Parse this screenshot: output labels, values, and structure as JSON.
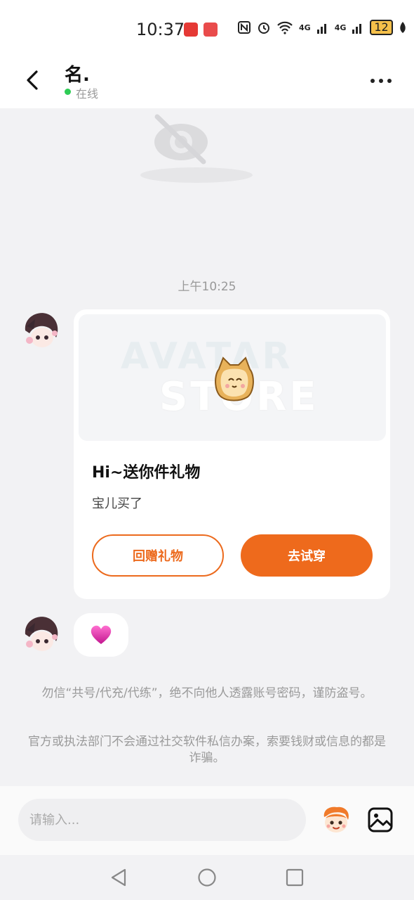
{
  "status_bar": {
    "time": "10:37",
    "battery": "12",
    "network_labels": [
      "4G",
      "4G"
    ]
  },
  "header": {
    "title": "名.",
    "status": "在线",
    "status_color": "#2ecc55"
  },
  "chat": {
    "timestamp": "上午10:25",
    "gift_card": {
      "banner_watermark_1": "AVATAR",
      "banner_watermark_2": "STORE",
      "title": "Hi~送你件礼物",
      "description": "宝儿买了",
      "return_gift_label": "回赠礼物",
      "try_on_label": "去试穿"
    },
    "heart_message": "💗",
    "notices": [
      "勿信“共号/代充/代练”，绝不向他人透露账号密码，谨防盗号。",
      "官方或执法部门不会通过社交软件私信办案，索要钱财或信息的都是诈骗。"
    ]
  },
  "input_bar": {
    "placeholder": "请输入..."
  },
  "colors": {
    "accent": "#ee6a1c",
    "background": "#f2f2f4"
  },
  "icons": [
    "back-arrow-icon",
    "more-icon",
    "hidden-eye-icon",
    "emoji-icon",
    "image-icon",
    "nav-back-icon",
    "nav-home-icon",
    "nav-recents-icon"
  ]
}
